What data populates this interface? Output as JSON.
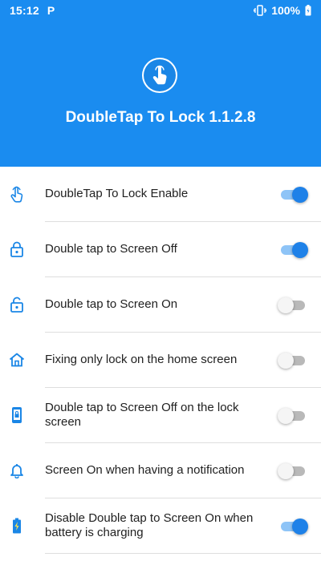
{
  "status_bar": {
    "time": "15:12",
    "p_indicator": "P",
    "battery": "100%"
  },
  "app": {
    "title": "DoubleTap To Lock 1.1.2.8",
    "icon": "touch-hand-icon"
  },
  "colors": {
    "primary": "#1a8cf0",
    "toggle_on": "#1e81e8",
    "toggle_on_track": "#8ec4f7",
    "toggle_off_track": "#b9b9b9",
    "icon_color": "#1a86e6"
  },
  "settings": [
    {
      "label": "DoubleTap To Lock Enable",
      "icon": "touch-hand-icon",
      "enabled": true
    },
    {
      "label": "Double tap to Screen Off",
      "icon": "lock-icon",
      "enabled": true
    },
    {
      "label": "Double tap to Screen On",
      "icon": "unlock-icon",
      "enabled": false
    },
    {
      "label": "Fixing only lock on the home screen",
      "icon": "home-icon",
      "enabled": false
    },
    {
      "label": "Double tap to Screen Off on the lock screen",
      "icon": "phone-lock-icon",
      "enabled": false
    },
    {
      "label": "Screen On when having a notification",
      "icon": "bell-icon",
      "enabled": false
    },
    {
      "label": "Disable Double tap to Screen On when battery is charging",
      "icon": "battery-charging-icon",
      "enabled": true
    }
  ]
}
